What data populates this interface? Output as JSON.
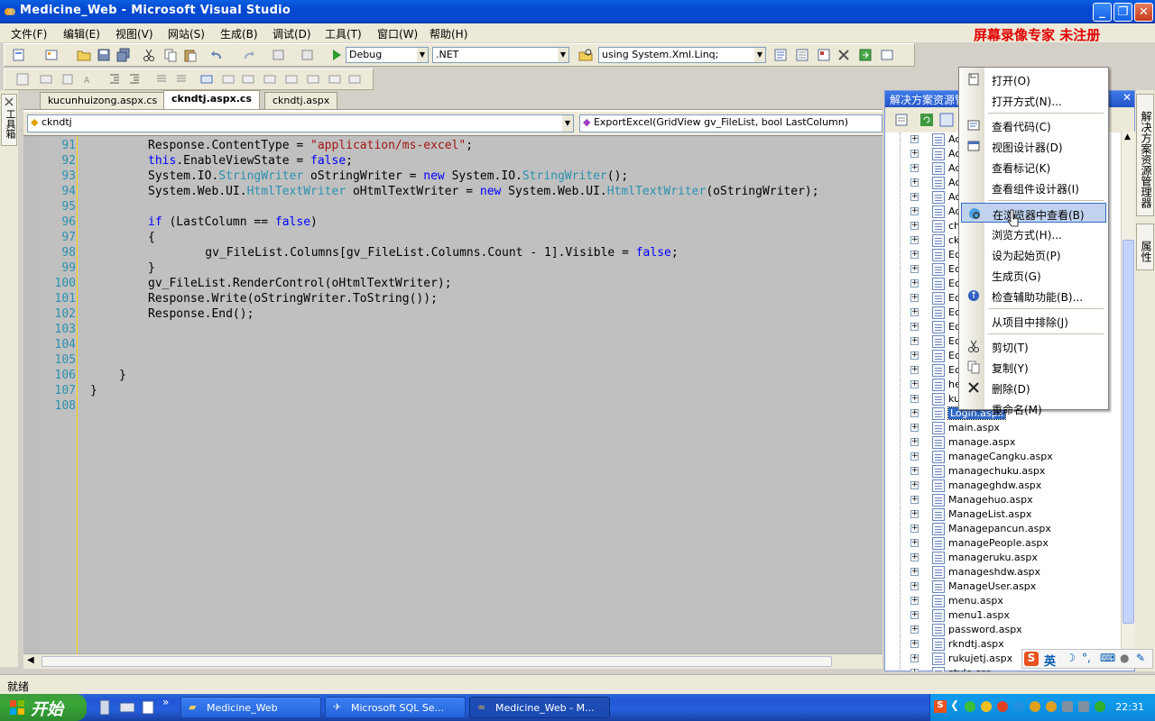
{
  "window": {
    "title": "Medicine_Web - Microsoft Visual Studio",
    "minimize": "_",
    "maximize": "❐",
    "close": "✕"
  },
  "watermark": "屏幕录像专家  未注册",
  "menu": [
    "文件(F)",
    "编辑(E)",
    "视图(V)",
    "网站(S)",
    "生成(B)",
    "调试(D)",
    "工具(T)",
    "窗口(W)",
    "帮助(H)"
  ],
  "toolbar": {
    "config": "Debug",
    "platform": ".NET",
    "find": "using System.Xml.Linq;"
  },
  "toolbox_label": "工具箱",
  "tabs": [
    {
      "label": "kucunhuizong.aspx.cs",
      "active": false
    },
    {
      "label": "ckndtj.aspx.cs",
      "active": true
    },
    {
      "label": "ckndtj.aspx",
      "active": false
    }
  ],
  "nav": {
    "class_combo": "ckndtj",
    "member_combo": "ExportExcel(GridView gv_FileList, bool LastColumn)"
  },
  "code": {
    "line_numbers": [
      "91",
      "92",
      "93",
      "94",
      "95",
      "96",
      "97",
      "98",
      "99",
      "100",
      "101",
      "102",
      "103",
      "104",
      "105",
      "106",
      "107",
      "108"
    ],
    "lines": [
      "Response.ContentType = \"application/ms-excel\";",
      "this.EnableViewState = false;",
      "System.IO.StringWriter oStringWriter = new System.IO.StringWriter();",
      "System.Web.UI.HtmlTextWriter oHtmlTextWriter = new System.Web.UI.HtmlTextWriter(oStringWriter);",
      "",
      "if (LastColumn == false)",
      "{",
      "    gv_FileList.Columns[gv_FileList.Columns.Count - 1].Visible = false;",
      "}",
      "gv_FileList.RenderControl(oHtmlTextWriter);",
      "Response.Write(oStringWriter.ToString());",
      "Response.End();",
      "",
      "",
      "",
      "}",
      "}",
      ""
    ]
  },
  "solution_explorer": {
    "title": "解决方案资源管",
    "items": [
      "Ac",
      "Ac",
      "Ac",
      "Ac",
      "Ac",
      "Ac",
      "ch",
      "ck",
      "Ec",
      "Ec",
      "Ec",
      "Ec",
      "Ec",
      "Ec",
      "Ec",
      "Ec",
      "Ec",
      "he",
      "ku",
      "Login.aspx",
      "main.aspx",
      "manage.aspx",
      "manageCangku.aspx",
      "managechuku.aspx",
      "manageghdw.aspx",
      "Managehuo.aspx",
      "ManageList.aspx",
      "Managepancun.aspx",
      "managePeople.aspx",
      "manageruku.aspx",
      "manageshdw.aspx",
      "ManageUser.aspx",
      "menu.aspx",
      "menu1.aspx",
      "password.aspx",
      "rkndtj.aspx",
      "rukujetj.aspx",
      "style.css"
    ],
    "selected": "Login.aspx"
  },
  "right_strip": {
    "panel1": "解决方案资源管理器",
    "panel2": "属性"
  },
  "context_menu": {
    "items": [
      {
        "label": "打开(O)",
        "icon": "open-icon"
      },
      {
        "label": "打开方式(N)...",
        "icon": ""
      },
      {
        "sep": true
      },
      {
        "label": "查看代码(C)",
        "icon": "code-icon"
      },
      {
        "label": "视图设计器(D)",
        "icon": "designer-icon"
      },
      {
        "label": "查看标记(K)",
        "icon": ""
      },
      {
        "label": "查看组件设计器(I)",
        "icon": ""
      },
      {
        "sep": true
      },
      {
        "label": "在浏览器中查看(B)",
        "icon": "browser-icon",
        "highlight": true
      },
      {
        "label": "浏览方式(H)...",
        "icon": ""
      },
      {
        "label": "设为起始页(P)",
        "icon": ""
      },
      {
        "label": "生成页(G)",
        "icon": ""
      },
      {
        "label": "检查辅助功能(B)...",
        "icon": "accessibility-icon"
      },
      {
        "sep": true
      },
      {
        "label": "从项目中排除(J)",
        "icon": ""
      },
      {
        "sep": true
      },
      {
        "label": "剪切(T)",
        "icon": "cut-icon"
      },
      {
        "label": "复制(Y)",
        "icon": "copy-icon"
      },
      {
        "label": "删除(D)",
        "icon": "delete-icon"
      },
      {
        "label": "重命名(M)",
        "icon": ""
      }
    ]
  },
  "status": "就绪",
  "ime": "英",
  "taskbar": {
    "start": "开始",
    "buttons": [
      "Medicine_Web",
      "Microsoft SQL Se...",
      "Medicine_Web - M..."
    ],
    "clock": "22:31"
  },
  "colors": {
    "keyword": "#0000ff",
    "string": "#a31515",
    "type": "#2b91af",
    "title_bar": "#0a4ad0",
    "highlight": "#316ac5"
  }
}
